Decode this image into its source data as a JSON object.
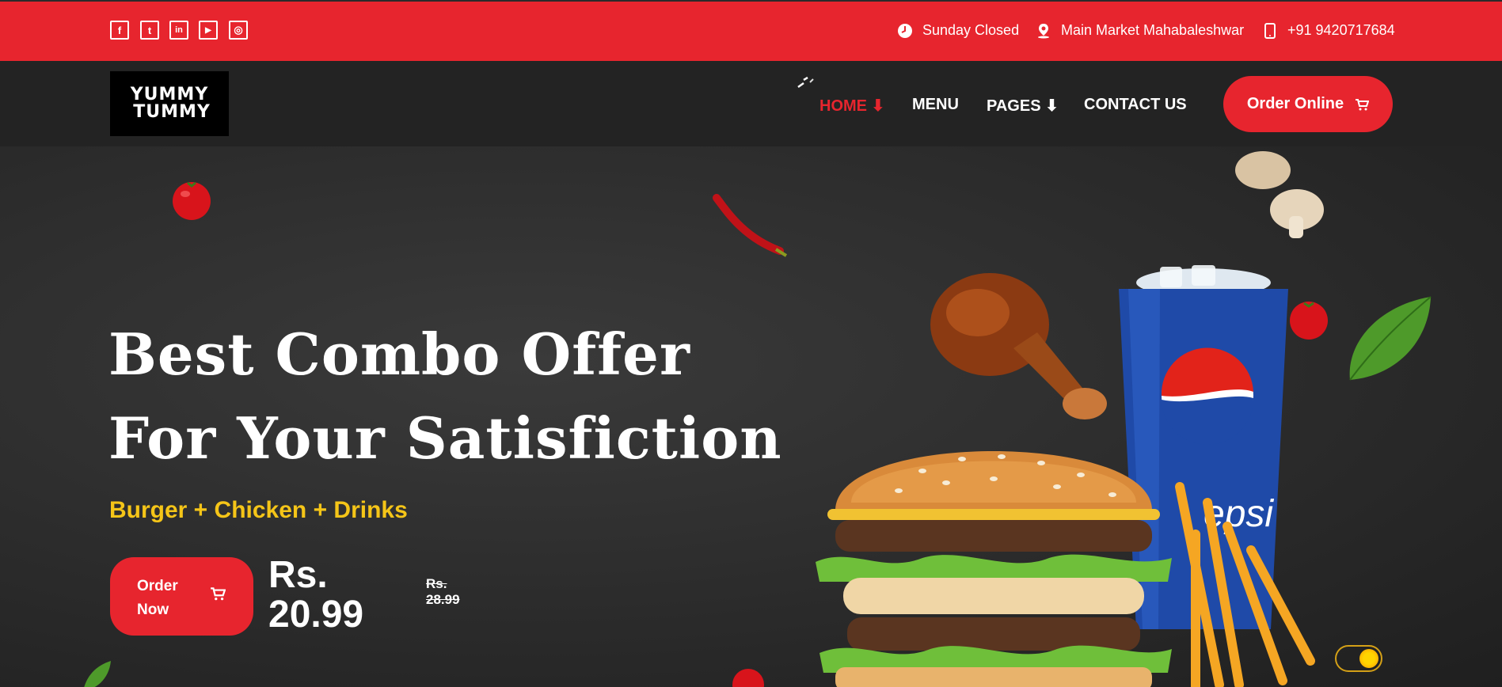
{
  "topbar": {
    "social": [
      {
        "name": "facebook-icon",
        "glyph": "f"
      },
      {
        "name": "twitter-icon",
        "glyph": "t"
      },
      {
        "name": "linkedin-icon",
        "glyph": "in"
      },
      {
        "name": "youtube-icon",
        "glyph": "▶"
      },
      {
        "name": "instagram-icon",
        "glyph": "◎"
      }
    ],
    "hours": "Sunday Closed",
    "address": "Main Market Mahabaleshwar",
    "phone": "+91 9420717684"
  },
  "logo": {
    "line1": "YUMMY",
    "line2": "TUMMY"
  },
  "nav": {
    "items": [
      "HOME ⬇",
      "MENU",
      "PAGES ⬇",
      "CONTACT US"
    ],
    "order_online": "Order Online"
  },
  "hero": {
    "title_line1": "Best Combo Offer",
    "title_line2": "For Your Satisfiction",
    "subtitle": "Burger + Chicken + Drinks",
    "order_now": "Order Now",
    "price": "Rs. 20.99",
    "old_price": "Rs. 28.99",
    "drink_brand": "epsi"
  },
  "colors": {
    "accent": "#e7252e",
    "highlight": "#f5c518",
    "nav_bg": "#232323"
  },
  "icons": [
    "clock-icon",
    "location-icon",
    "phone-icon",
    "cart-icon",
    "theme-toggle"
  ]
}
